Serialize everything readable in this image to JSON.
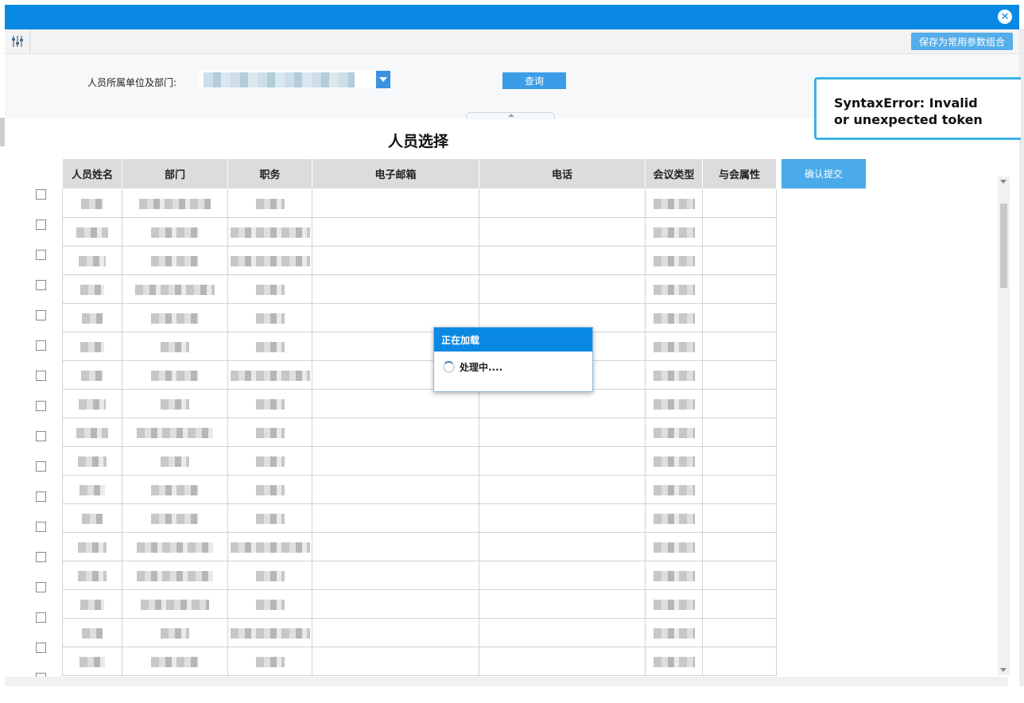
{
  "window": {
    "close_icon": "close-circle-icon"
  },
  "toolbar": {
    "settings_icon": "sliders-icon",
    "save_combo_label": "保存为常用参数组合"
  },
  "filter": {
    "dept_label": "人员所属单位及部门:",
    "query_label": "查询"
  },
  "page_title": "人员选择",
  "table": {
    "headers": [
      "人员姓名",
      "部门",
      "职务",
      "电子邮箱",
      "电话",
      "会议类型",
      "与会属性"
    ],
    "submit_label": "确认提交"
  },
  "loading": {
    "title": "正在加载",
    "message": "处理中...."
  },
  "error_toast": {
    "line1": "SyntaxError: Invalid",
    "line2": "or unexpected token"
  },
  "colors": {
    "primary": "#0a89e4",
    "button": "#3b9de8",
    "header_bg": "#dcdcdc",
    "error_border": "#3fb3e3"
  }
}
